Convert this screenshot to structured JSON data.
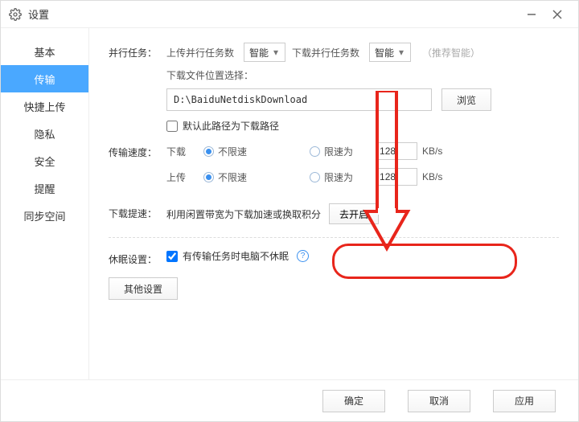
{
  "titlebar": {
    "title": "设置"
  },
  "sidebar": {
    "items": [
      {
        "label": "基本"
      },
      {
        "label": "传输"
      },
      {
        "label": "快捷上传"
      },
      {
        "label": "隐私"
      },
      {
        "label": "安全"
      },
      {
        "label": "提醒"
      },
      {
        "label": "同步空间"
      }
    ],
    "active": 1
  },
  "parallel": {
    "section_label": "并行任务：",
    "upload_label": "上传并行任务数",
    "download_label": "下载并行任务数",
    "upload_value": "智能",
    "download_value": "智能",
    "hint": "（推荐智能）"
  },
  "download_path": {
    "heading": "下载文件位置选择：",
    "value": "D:\\BaiduNetdiskDownload",
    "browse": "浏览",
    "default_checkbox": "默认此路径为下载路径"
  },
  "speed": {
    "section_label": "传输速度：",
    "download_label": "下载",
    "upload_label": "上传",
    "unlimited_label": "不限速",
    "limit_label": "限速为",
    "download_limit_value": "128",
    "upload_limit_value": "128",
    "unit": "KB/s"
  },
  "accel": {
    "section_label": "下载提速：",
    "desc": "利用闲置带宽为下载加速或换取积分",
    "button": "去开启"
  },
  "sleep": {
    "section_label": "休眠设置：",
    "checkbox_label": "有传输任务时电脑不休眠"
  },
  "other_button": "其他设置",
  "footer": {
    "ok": "确定",
    "cancel": "取消",
    "apply": "应用"
  }
}
